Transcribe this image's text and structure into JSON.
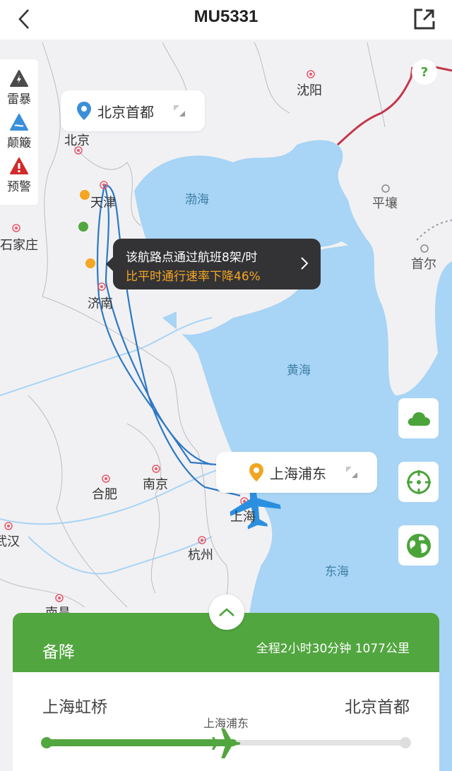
{
  "header": {
    "title": "MU5331",
    "back_icon": "chevron-left-icon",
    "share_icon": "share-external-icon"
  },
  "legend": {
    "items": [
      {
        "label": "雷暴",
        "icon": "thunderstorm-icon",
        "color": "#4a4a4a"
      },
      {
        "label": "颠簸",
        "icon": "turbulence-icon",
        "color": "#3a8fd9"
      },
      {
        "label": "预警",
        "icon": "warning-icon",
        "color": "#d12b2b"
      }
    ]
  },
  "map": {
    "cities": [
      "北京",
      "天津",
      "石家庄",
      "济南",
      "沈阳",
      "平壤",
      "首尔",
      "合肥",
      "南京",
      "上海",
      "杭州",
      "武汉",
      "南昌"
    ],
    "seas": [
      "渤海",
      "黄海",
      "东海"
    ],
    "origin_card": {
      "name": "北京首都"
    },
    "dest_card": {
      "name": "上海浦东"
    },
    "help_label": "?",
    "colors": {
      "water": "#a8d4f5",
      "land": "#f1f1f3",
      "route": "#2d78c4",
      "border": "#c4374a",
      "accent": "#52a63f"
    }
  },
  "tooltip": {
    "line1": "该航路点通过航班8架/时",
    "line2": "比平时通行速率下降46%"
  },
  "side_buttons": [
    {
      "name": "weather-layer-button",
      "icon": "cloud-icon"
    },
    {
      "name": "locate-button",
      "icon": "crosshair-icon"
    },
    {
      "name": "globe-view-button",
      "icon": "globe-icon"
    }
  ],
  "panel": {
    "status": "备降",
    "summary": "全程2小时30分钟 1077公里",
    "from": "上海虹桥",
    "to": "北京首都",
    "diverted_to": "上海浦东",
    "progress": 0.53
  }
}
